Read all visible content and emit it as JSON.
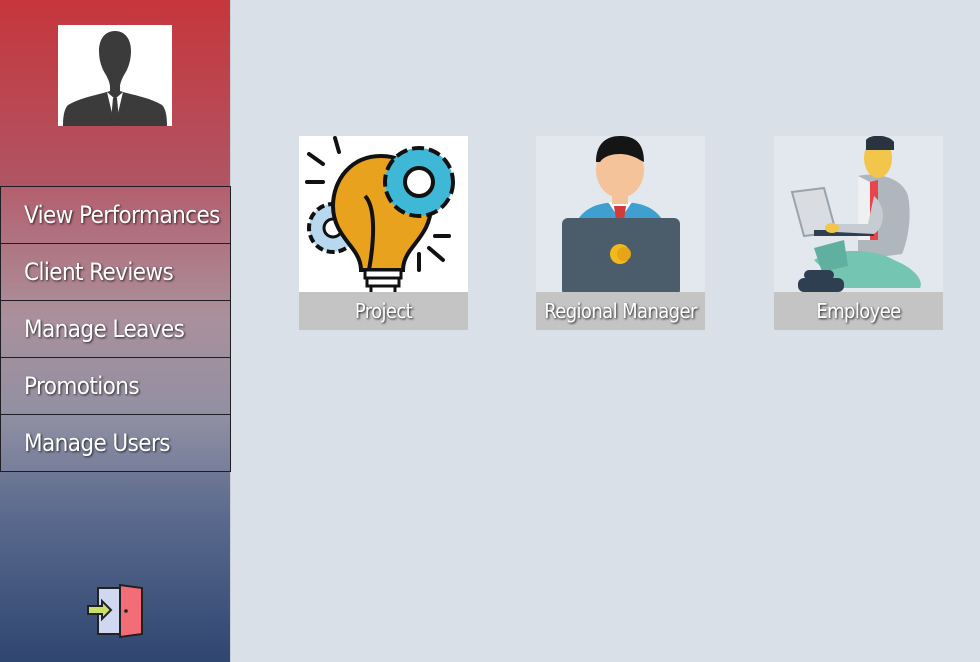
{
  "sidebar": {
    "avatar_icon": "user-silhouette-icon",
    "menu": [
      {
        "label": "View Performances"
      },
      {
        "label": "Client Reviews"
      },
      {
        "label": "Manage Leaves"
      },
      {
        "label": "Promotions"
      },
      {
        "label": "Manage Users"
      }
    ],
    "logout_icon": "logout-door-icon"
  },
  "cards": [
    {
      "label": "Project",
      "icon": "lightbulb-gears-icon"
    },
    {
      "label": "Regional Manager",
      "icon": "manager-laptop-icon"
    },
    {
      "label": "Employee",
      "icon": "employee-laptop-icon"
    }
  ],
  "colors": {
    "sidebar_top": "#c6363b",
    "sidebar_bottom": "#2f4670",
    "page_background": "#d9e0e8",
    "caption_background": "#c4c4c4"
  }
}
